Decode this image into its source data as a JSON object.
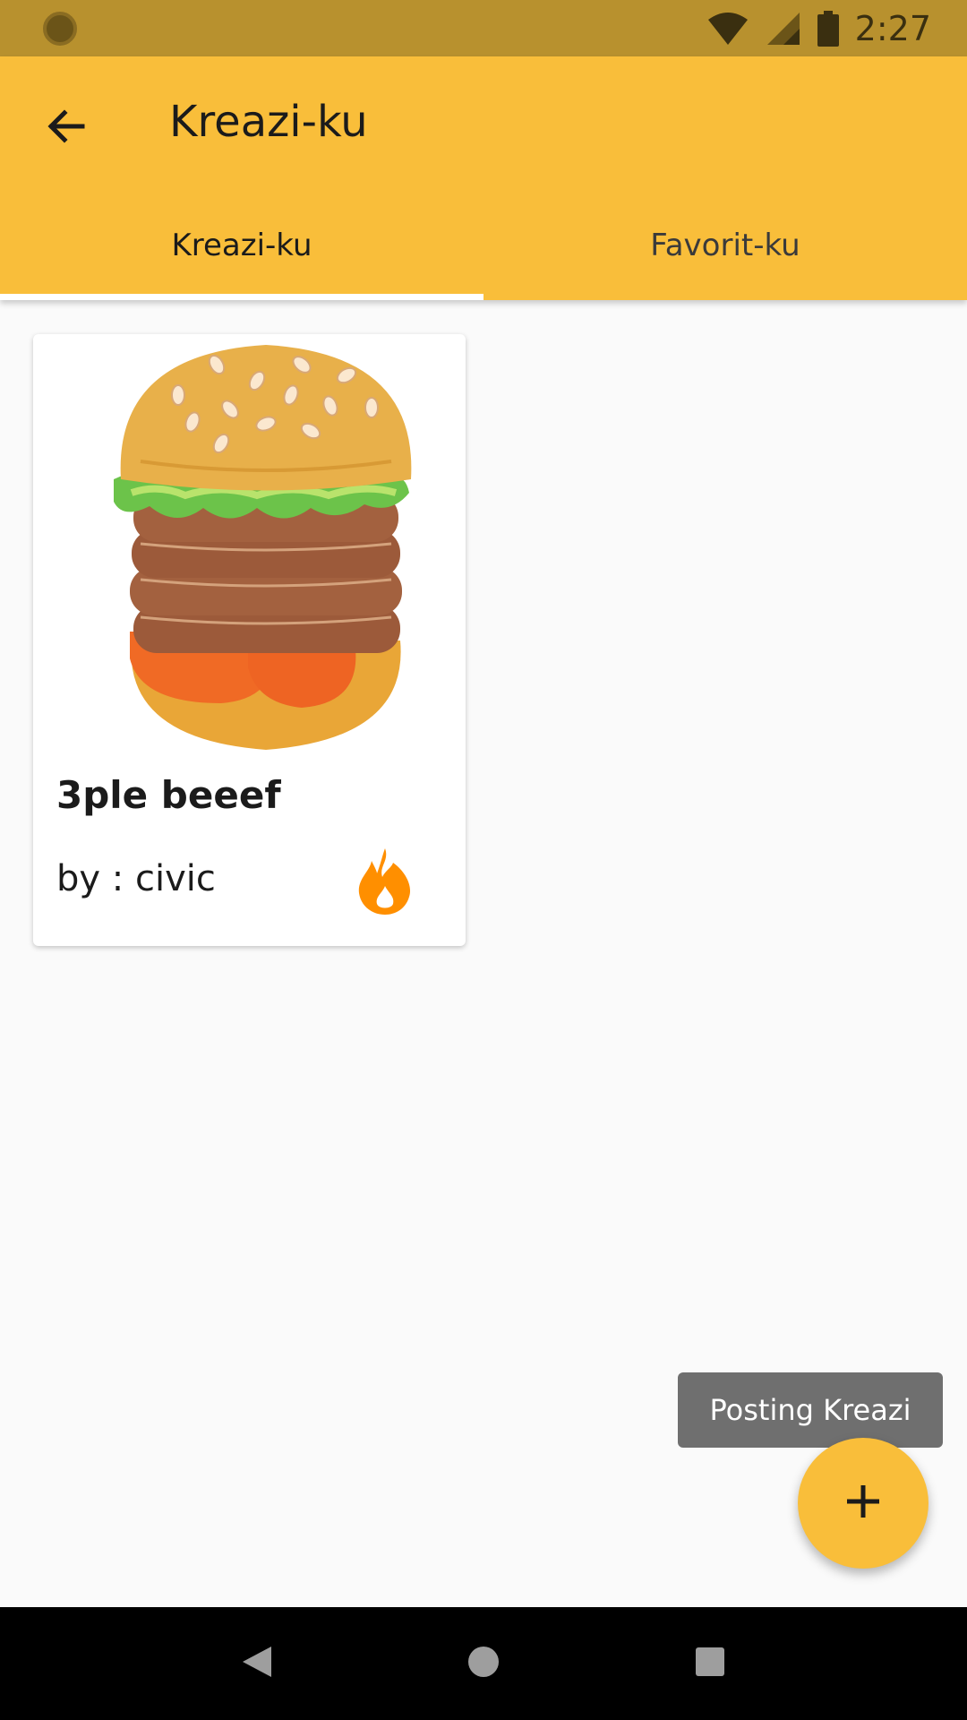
{
  "status_bar": {
    "time": "2:27",
    "icons": [
      "notification-dot-icon",
      "wifi-icon",
      "cell-signal-icon",
      "battery-icon"
    ]
  },
  "app_bar": {
    "title": "Kreazi-ku",
    "back_icon": "arrow-back-icon",
    "color": "#f9be3a"
  },
  "tabs": [
    {
      "label": "Kreazi-ku",
      "selected": true
    },
    {
      "label": "Favorit-ku",
      "selected": false
    }
  ],
  "cards": [
    {
      "title": "3ple beeef",
      "author": "by : civic",
      "image": "burger-image",
      "action_icon": "fire-icon",
      "action_color": "#ff8f00"
    }
  ],
  "tooltip": {
    "text": "Posting Kreazi"
  },
  "fab": {
    "icon": "plus-icon"
  },
  "nav_bar": {
    "icons": [
      "back-triangle-icon",
      "home-circle-icon",
      "recents-square-icon"
    ]
  }
}
